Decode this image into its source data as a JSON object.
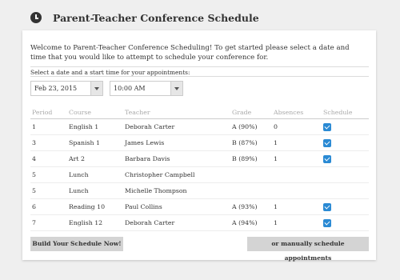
{
  "header": {
    "icon": "clock-icon",
    "title": "Parent-Teacher Conference Schedule"
  },
  "intro": {
    "welcome": "Welcome to Parent-Teacher Conference Scheduling! To get started please select a date and time that you would like to attempt to schedule your conference for.",
    "select_label": "Select a date and a start time for your appointments:"
  },
  "selectors": {
    "date": "Feb 23, 2015",
    "time": "10:00 AM"
  },
  "table": {
    "columns": [
      "Period",
      "Course",
      "Teacher",
      "Grade",
      "Absences",
      "Schedule"
    ],
    "rows": [
      {
        "period": "1",
        "course": "English 1",
        "teacher": "Deborah Carter",
        "grade": "A (90%)",
        "absences": "0",
        "schedule": true
      },
      {
        "period": "3",
        "course": "Spanish 1",
        "teacher": "James Lewis",
        "grade": "B (87%)",
        "absences": "1",
        "schedule": true
      },
      {
        "period": "4",
        "course": "Art 2",
        "teacher": "Barbara Davis",
        "grade": "B (89%)",
        "absences": "1",
        "schedule": true
      },
      {
        "period": "5",
        "course": "Lunch",
        "teacher": "Christopher Campbell",
        "grade": "",
        "absences": "",
        "schedule": false
      },
      {
        "period": "5",
        "course": "Lunch",
        "teacher": "Michelle Thompson",
        "grade": "",
        "absences": "",
        "schedule": false
      },
      {
        "period": "6",
        "course": "Reading 10",
        "teacher": "Paul Collins",
        "grade": "A (93%)",
        "absences": "1",
        "schedule": true
      },
      {
        "period": "7",
        "course": "English 12",
        "teacher": "Deborah Carter",
        "grade": "A (94%)",
        "absences": "1",
        "schedule": true
      }
    ]
  },
  "buttons": {
    "build": "Build Your Schedule Now!",
    "manual": "or manually schedule appointments"
  },
  "colors": {
    "checkbox": "#2a8ad4",
    "button_bg": "#d4d4d4",
    "page_bg": "#efefef"
  }
}
